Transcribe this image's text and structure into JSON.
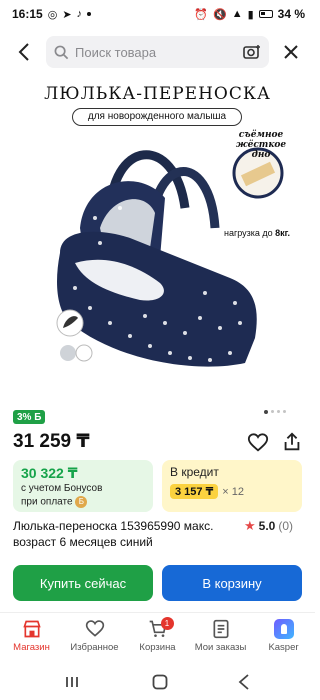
{
  "status_bar": {
    "time": "16:15",
    "battery": "34 %"
  },
  "search": {
    "placeholder": "Поиск товара"
  },
  "image": {
    "headline": "ЛЮЛЬКА-ПЕРЕНОСКА",
    "subheadline": "для новорожденного малыша",
    "note": "съёмное жёсткое дно",
    "load_label": "нагрузка до",
    "load_value": "8кг."
  },
  "badge": {
    "label": "3% Б"
  },
  "price": "31 259 ₸",
  "bonus_card": {
    "price": "30 322 ₸",
    "line1": "с учетом Бонусов",
    "line2": "при оплате"
  },
  "credit_card": {
    "label": "В кредит",
    "amount": "3 157 ₸",
    "multiplier": "× 12"
  },
  "product": {
    "title": "Люлька-переноска 153965990 макс. возраст 6 месяцев синий",
    "rating": "5.0",
    "reviews": "(0)"
  },
  "buttons": {
    "buy": "Купить сейчас",
    "cart": "В корзину"
  },
  "nav": {
    "items": [
      {
        "label": "Магазин"
      },
      {
        "label": "Избранное"
      },
      {
        "label": "Корзина",
        "badge": "1"
      },
      {
        "label": "Мои заказы"
      },
      {
        "label": "Kasper"
      }
    ]
  },
  "colors": {
    "accent": "#e4352d",
    "green": "#1fa046",
    "blue": "#1769d6",
    "yellow": "#fbd23f"
  }
}
